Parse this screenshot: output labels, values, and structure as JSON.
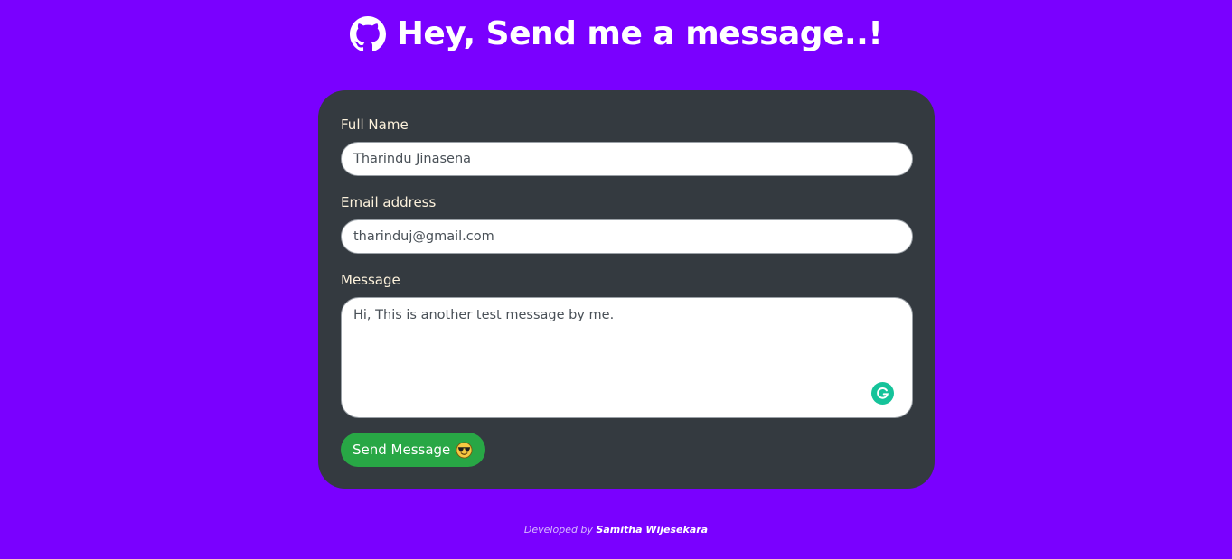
{
  "header": {
    "title": "Hey, Send me a message..!",
    "icon": "github-icon"
  },
  "form": {
    "full_name": {
      "label": "Full Name",
      "value": "Tharindu Jinasena"
    },
    "email": {
      "label": "Email address",
      "value": "tharinduj@gmail.com"
    },
    "message": {
      "label": "Message",
      "value": "Hi, This is another test message by me."
    },
    "grammarly_icon": "grammarly-icon",
    "send_button": {
      "label": "Send Message",
      "icon": "sunglasses-emoji-icon"
    }
  },
  "footer": {
    "prefix": "Developed by",
    "author": "Samitha Wijesekara"
  },
  "colors": {
    "background": "#7a00ff",
    "card": "#343a40",
    "label": "#fdf2dc",
    "button": "#28a745",
    "grammarly": "#15c39a"
  }
}
